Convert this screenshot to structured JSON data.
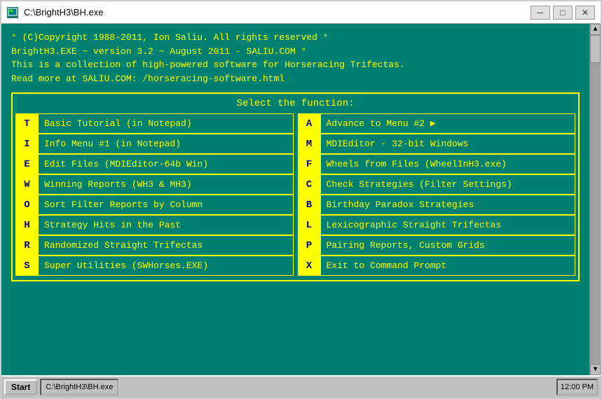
{
  "window": {
    "title": "C:\\BrightH3\\BH.exe",
    "minimize_label": "─",
    "maximize_label": "□",
    "close_label": "✕"
  },
  "header": {
    "line1": "° (C)Copyright 1988-2011, Ion Saliu. All rights reserved °",
    "line2": "BrightH3.EXE ~ version 3.2 ~ August 2011 - SALIU.COM °",
    "line3": "This is a collection of high-powered software for Horseracing Trifectas.",
    "line4": "Read more at SALIU.COM: /horseracing-software.html"
  },
  "menu": {
    "title": "Select the function:",
    "rows": [
      {
        "left": {
          "key": "T",
          "label": "Basic Tutorial (in Notepad)"
        },
        "right": {
          "key": "A",
          "label": "Advance to Menu #2 ▶"
        }
      },
      {
        "left": {
          "key": "I",
          "label": "Info Menu #1 (in Notepad)"
        },
        "right": {
          "key": "M",
          "label": "MDIEditor - 32-bit Windows"
        }
      },
      {
        "left": {
          "key": "E",
          "label": "Edit Files (MDIEditor-64b Win)"
        },
        "right": {
          "key": "F",
          "label": "Wheels from Files (WheelInH3.exe)"
        }
      },
      {
        "left": {
          "key": "W",
          "label": "Winning Reports (WH3 & MH3)"
        },
        "right": {
          "key": "C",
          "label": "Check Strategies (Filter Settings)"
        }
      },
      {
        "left": {
          "key": "O",
          "label": "Sort Filter Reports by Column"
        },
        "right": {
          "key": "B",
          "label": "Birthday Paradox Strategies"
        }
      },
      {
        "left": {
          "key": "H",
          "label": "Strategy Hits in the Past"
        },
        "right": {
          "key": "L",
          "label": "Lexicographic Straight Trifectas"
        }
      },
      {
        "left": {
          "key": "R",
          "label": "Randomized Straight Trifectas"
        },
        "right": {
          "key": "P",
          "label": "Pairing Reports, Custom Grids"
        }
      },
      {
        "left": {
          "key": "S",
          "label": "Super Utilities (SWHorses.EXE)"
        },
        "right": {
          "key": "X",
          "label": "Exit to Command Prompt"
        }
      }
    ]
  },
  "scrollbar": {
    "up_arrow": "▲",
    "down_arrow": "▼"
  },
  "taskbar": {
    "start_label": "Start",
    "items": [
      "C:\\BrightH3\\BH.exe"
    ],
    "tray_time": "12:00 PM"
  }
}
